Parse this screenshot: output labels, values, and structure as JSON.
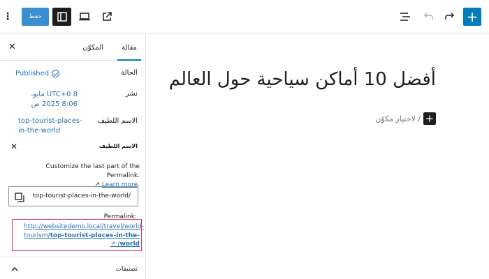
{
  "toolbar": {
    "save_label": "حفظ",
    "add_label": "+"
  },
  "sidebar": {
    "tabs": [
      {
        "label": "مقالة",
        "active": true
      },
      {
        "label": "المكوّن",
        "active": false
      }
    ],
    "status": {
      "label": "الحالة",
      "value": "Published"
    },
    "publish": {
      "label": "نشر",
      "value_line1": "UTC+0 8 مايو،",
      "value_line2": "8:06 2025 ص"
    },
    "slug": {
      "label": "الاسم اللطيف",
      "value_line1": "top-tourist-places-",
      "value_line2": "in-the-world"
    },
    "slug_panel": {
      "title": "الاسم اللطيف",
      "help_text": "Customize the last part of the Permalink.",
      "learn_more": "Learn more",
      "input_value": "top-tourist-places-in-the-world/",
      "permalink_label": "Permalink:",
      "permalink_prefix_line1": "http://websitedemo.local/travel/world-",
      "permalink_prefix_line2": "tourism/",
      "permalink_slug_line2": "top-tourist-places-in-the-",
      "permalink_slug_line3": "world",
      "permalink_suffix": "/"
    },
    "categories": {
      "label": "تصنيفات"
    }
  },
  "editor": {
    "title": "أفضل 10 أماكن سياحية حول العالم",
    "appender_text": "/ لاختيار مكوّن",
    "inserter_label": "+"
  },
  "colors": {
    "accent": "#007cba",
    "link": "#2271b1",
    "highlight_border": "#d6336c"
  }
}
